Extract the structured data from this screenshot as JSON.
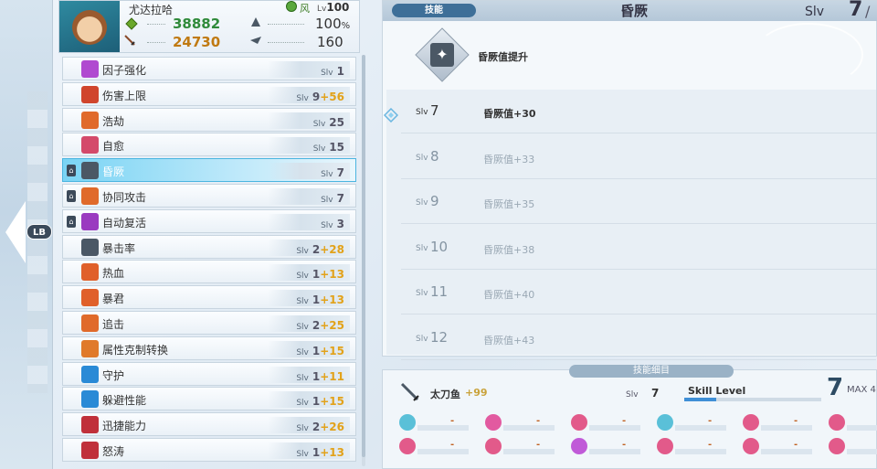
{
  "character": {
    "name": "尤达拉哈",
    "element_label": "风",
    "level_label": "Lv",
    "level": "100",
    "hp": "38882",
    "attack": "24730",
    "crit": "100",
    "crit_unit": "%",
    "speed": "160"
  },
  "nav": {
    "lb_label": "LB"
  },
  "skills": [
    {
      "name": "因子强化",
      "slv_label": "Slv",
      "level": "1",
      "bonus": "",
      "icon_color": "#b04ad0",
      "locked": false
    },
    {
      "name": "伤害上限",
      "slv_label": "Slv",
      "level": "9",
      "bonus": "+56",
      "icon_color": "#d0452c",
      "locked": false
    },
    {
      "name": "浩劫",
      "slv_label": "Slv",
      "level": "25",
      "bonus": "",
      "icon_color": "#e06a2a",
      "locked": false
    },
    {
      "name": "自愈",
      "slv_label": "Slv",
      "level": "15",
      "bonus": "",
      "icon_color": "#d44a6a",
      "locked": false
    },
    {
      "name": "昏厥",
      "slv_label": "Slv",
      "level": "7",
      "bonus": "",
      "icon_color": "#4b5865",
      "locked": true,
      "selected": true
    },
    {
      "name": "协同攻击",
      "slv_label": "Slv",
      "level": "7",
      "bonus": "",
      "icon_color": "#e06a2a",
      "locked": true
    },
    {
      "name": "自动复活",
      "slv_label": "Slv",
      "level": "3",
      "bonus": "",
      "icon_color": "#9a3ac0",
      "locked": true
    },
    {
      "name": "暴击率",
      "slv_label": "Slv",
      "level": "2",
      "bonus": "+28",
      "icon_color": "#4b5865",
      "locked": false
    },
    {
      "name": "热血",
      "slv_label": "Slv",
      "level": "1",
      "bonus": "+13",
      "icon_color": "#e0602a",
      "locked": false
    },
    {
      "name": "暴君",
      "slv_label": "Slv",
      "level": "1",
      "bonus": "+13",
      "icon_color": "#e0602a",
      "locked": false
    },
    {
      "name": "追击",
      "slv_label": "Slv",
      "level": "2",
      "bonus": "+25",
      "icon_color": "#e06a2a",
      "locked": false
    },
    {
      "name": "属性克制转换",
      "slv_label": "Slv",
      "level": "1",
      "bonus": "+15",
      "icon_color": "#e07a2a",
      "locked": false
    },
    {
      "name": "守护",
      "slv_label": "Slv",
      "level": "1",
      "bonus": "+11",
      "icon_color": "#2a8ad6",
      "locked": false
    },
    {
      "name": "躲避性能",
      "slv_label": "Slv",
      "level": "1",
      "bonus": "+15",
      "icon_color": "#2a8ad6",
      "locked": false
    },
    {
      "name": "迅捷能力",
      "slv_label": "Slv",
      "level": "2",
      "bonus": "+26",
      "icon_color": "#c0303a",
      "locked": false
    },
    {
      "name": "怒涛",
      "slv_label": "Slv",
      "level": "1",
      "bonus": "+13",
      "icon_color": "#c0303a",
      "locked": false
    }
  ],
  "detail": {
    "category": "技能",
    "title": "昏厥",
    "slv_label": "Slv",
    "slv_value": "7",
    "slv_max_partial": "/",
    "description": "昏厥值提升",
    "levels": [
      {
        "label": "Slv",
        "num": "7",
        "text": "昏厥值+30",
        "current": true
      },
      {
        "label": "Slv",
        "num": "8",
        "text": "昏厥值+33",
        "current": false
      },
      {
        "label": "Slv",
        "num": "9",
        "text": "昏厥值+35",
        "current": false
      },
      {
        "label": "Slv",
        "num": "10",
        "text": "昏厥值+38",
        "current": false
      },
      {
        "label": "Slv",
        "num": "11",
        "text": "昏厥值+40",
        "current": false
      },
      {
        "label": "Slv",
        "num": "12",
        "text": "昏厥值+43",
        "current": false
      }
    ]
  },
  "bottom": {
    "title": "技能细目",
    "weapon_name": "太刀鱼",
    "weapon_bonus": "+99",
    "slv_label": "Slv",
    "slv_value": "7",
    "skill_level_label": "Skill Level",
    "skill_level_value": "7",
    "skill_level_fraction": 0.23,
    "max_label": "MAX 4",
    "row1": [
      {
        "color": "#5ac0d8",
        "dash": "-"
      },
      {
        "color": "#e25aa0",
        "dash": "-"
      },
      {
        "color": "#e25a8a",
        "dash": "-"
      },
      {
        "color": "#5ac0d8",
        "dash": "-"
      },
      {
        "color": "#e25a8a",
        "dash": "-"
      },
      {
        "color": "#e25a8a",
        "dash": "-"
      }
    ],
    "row2": [
      {
        "color": "#e25a8a",
        "dash": "-"
      },
      {
        "color": "#e25a8a",
        "dash": "-"
      },
      {
        "color": "#c05ad8",
        "dash": "-"
      },
      {
        "color": "#e25a8a",
        "dash": "-"
      },
      {
        "color": "#e25a8a",
        "dash": "-"
      },
      {
        "color": "#e25a8a",
        "dash": "-"
      }
    ]
  }
}
